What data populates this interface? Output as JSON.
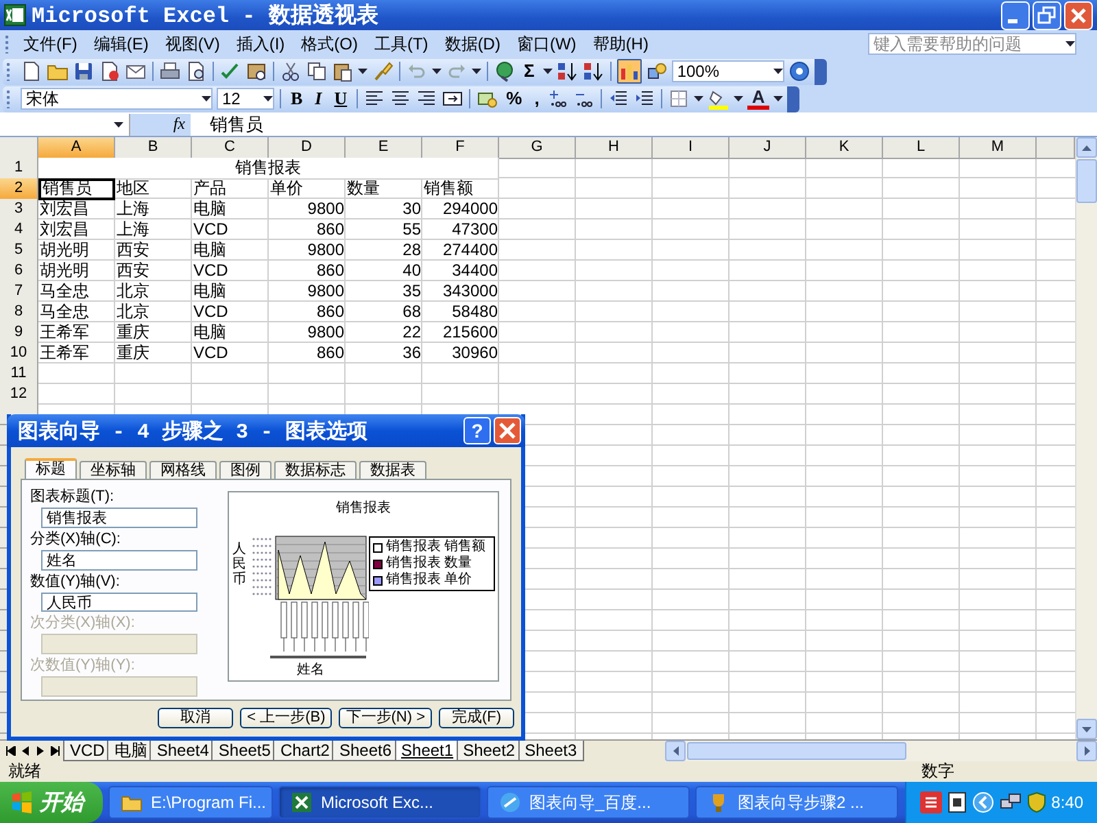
{
  "window": {
    "title": "Microsoft Excel - 数据透视表"
  },
  "menu": [
    "文件(F)",
    "编辑(E)",
    "视图(V)",
    "插入(I)",
    "格式(O)",
    "工具(T)",
    "数据(D)",
    "窗口(W)",
    "帮助(H)"
  ],
  "help_search": {
    "placeholder": "键入需要帮助的问题"
  },
  "standard_toolbar": {
    "sum_button": "Σ",
    "chart_wizard_pressed": true,
    "zoom": "100%"
  },
  "formatting_toolbar": {
    "font": "宋体",
    "size": "12",
    "style_buttons": [
      "B",
      "I",
      "U"
    ],
    "percent_button": "%",
    "comma_button": ",",
    "font_color_button": "A"
  },
  "formula_bar": {
    "function_button": "fx",
    "value": "销售员"
  },
  "sheet": {
    "columns": [
      {
        "label": "A",
        "selected": true
      },
      {
        "label": "B",
        "selected": false
      },
      {
        "label": "C",
        "selected": false
      },
      {
        "label": "D",
        "selected": false
      },
      {
        "label": "E",
        "selected": false
      },
      {
        "label": "F",
        "selected": false
      },
      {
        "label": "G",
        "selected": false
      },
      {
        "label": "H",
        "selected": false
      },
      {
        "label": "I",
        "selected": false
      },
      {
        "label": "J",
        "selected": false
      },
      {
        "label": "K",
        "selected": false
      },
      {
        "label": "L",
        "selected": false
      },
      {
        "label": "M",
        "selected": false
      }
    ],
    "rows": [
      {
        "number": "1",
        "selected": false,
        "kind": "title",
        "cells": [
          "销售报表"
        ]
      },
      {
        "number": "2",
        "selected": true,
        "kind": "header",
        "cells": [
          "销售员",
          "地区",
          "产品",
          "单价",
          "数量",
          "销售额"
        ]
      },
      {
        "number": "3",
        "selected": false,
        "kind": "data",
        "cells": [
          "刘宏昌",
          "上海",
          "电脑",
          "9800",
          "30",
          "294000"
        ]
      },
      {
        "number": "4",
        "selected": false,
        "kind": "data",
        "cells": [
          "刘宏昌",
          "上海",
          "VCD",
          "860",
          "55",
          "47300"
        ]
      },
      {
        "number": "5",
        "selected": false,
        "kind": "data",
        "cells": [
          "胡光明",
          "西安",
          "电脑",
          "9800",
          "28",
          "274400"
        ]
      },
      {
        "number": "6",
        "selected": false,
        "kind": "data",
        "cells": [
          "胡光明",
          "西安",
          "VCD",
          "860",
          "40",
          "34400"
        ]
      },
      {
        "number": "7",
        "selected": false,
        "kind": "data",
        "cells": [
          "马全忠",
          "北京",
          "电脑",
          "9800",
          "35",
          "343000"
        ]
      },
      {
        "number": "8",
        "selected": false,
        "kind": "data",
        "cells": [
          "马全忠",
          "北京",
          "VCD",
          "860",
          "68",
          "58480"
        ]
      },
      {
        "number": "9",
        "selected": false,
        "kind": "data",
        "cells": [
          "王希军",
          "重庆",
          "电脑",
          "9800",
          "22",
          "215600"
        ]
      },
      {
        "number": "10",
        "selected": false,
        "kind": "data",
        "cells": [
          "王希军",
          "重庆",
          "VCD",
          "860",
          "36",
          "30960"
        ]
      },
      {
        "number": "11",
        "selected": false,
        "kind": "empty"
      },
      {
        "number": "12",
        "selected": false,
        "kind": "empty"
      }
    ]
  },
  "sheet_tabs": [
    {
      "label": "VCD",
      "selected": false
    },
    {
      "label": "电脑",
      "selected": false
    },
    {
      "label": "Sheet4",
      "selected": false
    },
    {
      "label": "Sheet5",
      "selected": false
    },
    {
      "label": "Chart2",
      "selected": false
    },
    {
      "label": "Sheet6",
      "selected": false
    },
    {
      "label": "Sheet1",
      "selected": true
    },
    {
      "label": "Sheet2",
      "selected": false
    },
    {
      "label": "Sheet3",
      "selected": false
    }
  ],
  "status_bar": {
    "status": "就绪",
    "mode": "数字"
  },
  "dialog": {
    "title": "图表向导 - 4 步骤之 3 - 图表选项",
    "help_button": "?",
    "tabs": [
      {
        "label": "标题",
        "selected": true
      },
      {
        "label": "坐标轴",
        "selected": false
      },
      {
        "label": "网格线",
        "selected": false
      },
      {
        "label": "图例",
        "selected": false
      },
      {
        "label": "数据标志",
        "selected": false
      },
      {
        "label": "数据表",
        "selected": false
      }
    ],
    "fields": [
      {
        "label": "图表标题(T):",
        "value": "销售报表",
        "disabled": false
      },
      {
        "label": "分类(X)轴(C):",
        "value": "姓名",
        "disabled": false
      },
      {
        "label": "数值(Y)轴(V):",
        "value": "人民币",
        "disabled": false
      },
      {
        "label": "次分类(X)轴(X):",
        "disabled": true
      },
      {
        "label": "次数值(Y)轴(Y):",
        "disabled": true
      }
    ],
    "preview": {
      "title": "销售报表",
      "y_axis_label": "人民币",
      "x_axis_label": "姓名",
      "legend": [
        {
          "label": "销售报表 销售额",
          "color": "#ffffff"
        },
        {
          "label": "销售报表 数量",
          "color": "#800040"
        },
        {
          "label": "销售报表 单价",
          "color": "#9999ff"
        }
      ]
    },
    "buttons": [
      "取消",
      "< 上一步(B)",
      "下一步(N) >",
      "完成(F)"
    ]
  },
  "taskbar": {
    "start": "开始",
    "tasks": [
      {
        "label": "E:\\Program Fi...",
        "selected": false
      },
      {
        "label": "Microsoft Exc...",
        "selected": true
      },
      {
        "label": "图表向导_百度...",
        "selected": false
      },
      {
        "label": "图表向导步骤2 ...",
        "selected": false
      }
    ],
    "clock": "8:40"
  }
}
